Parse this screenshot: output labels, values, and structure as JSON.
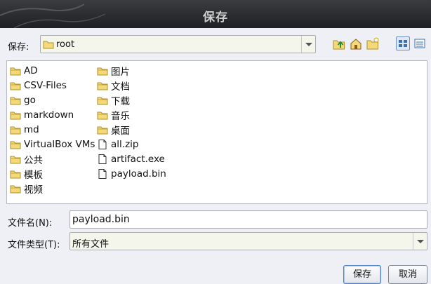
{
  "window": {
    "title": "保存"
  },
  "location": {
    "label": "保存:",
    "value": "root"
  },
  "folders_col1": [
    {
      "name": "AD",
      "icon": "folder-icon"
    },
    {
      "name": "CSV-Files",
      "icon": "folder-icon"
    },
    {
      "name": "go",
      "icon": "folder-icon"
    },
    {
      "name": "markdown",
      "icon": "folder-icon"
    },
    {
      "name": "md",
      "icon": "folder-icon"
    },
    {
      "name": "VirtualBox VMs",
      "icon": "folder-icon"
    },
    {
      "name": "公共",
      "icon": "folder-icon"
    },
    {
      "name": "模板",
      "icon": "folder-icon"
    },
    {
      "name": "视频",
      "icon": "folder-icon"
    }
  ],
  "folders_col2": [
    {
      "name": "图片",
      "icon": "folder-icon"
    },
    {
      "name": "文档",
      "icon": "folder-icon"
    },
    {
      "name": "下载",
      "icon": "folder-icon"
    },
    {
      "name": "音乐",
      "icon": "folder-icon"
    },
    {
      "name": "桌面",
      "icon": "folder-icon"
    },
    {
      "name": "all.zip",
      "icon": "file-icon"
    },
    {
      "name": "artifact.exe",
      "icon": "file-icon"
    },
    {
      "name": "payload.bin",
      "icon": "file-icon"
    }
  ],
  "filename": {
    "label": "文件名(N):",
    "value": "payload.bin"
  },
  "filetype": {
    "label": "文件类型(T):",
    "value": "所有文件"
  },
  "buttons": {
    "save": "保存",
    "cancel": "取消"
  },
  "colors": {
    "folder": "#e9c24c",
    "titlebar": "#2a2b2e",
    "accent": "#4f7fc8"
  }
}
